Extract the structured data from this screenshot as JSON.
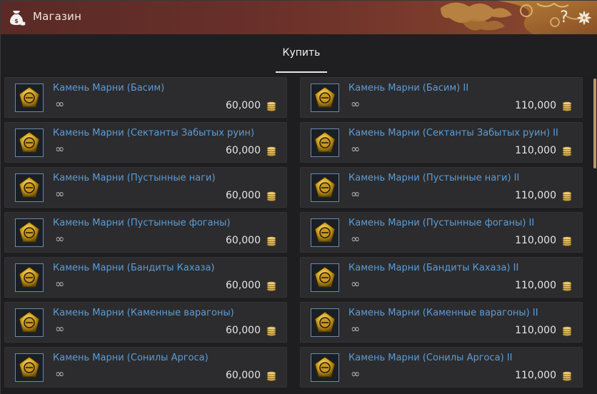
{
  "window": {
    "title": "Магазин",
    "help_label": "?"
  },
  "tabs": [
    {
      "label": "Купить",
      "active": true
    }
  ],
  "items": [
    {
      "name": "Камень Марни (Басим)",
      "quantity": "∞",
      "price": "60,000",
      "icon": "marni-stone-icon"
    },
    {
      "name": "Камень Марни (Басим) II",
      "quantity": "∞",
      "price": "110,000",
      "icon": "marni-stone-icon"
    },
    {
      "name": "Камень Марни (Сектанты Забытых руин)",
      "quantity": "∞",
      "price": "60,000",
      "icon": "marni-stone-icon"
    },
    {
      "name": "Камень Марни (Сектанты Забытых руин) II",
      "quantity": "∞",
      "price": "110,000",
      "icon": "marni-stone-icon"
    },
    {
      "name": "Камень Марни (Пустынные наги)",
      "quantity": "∞",
      "price": "60,000",
      "icon": "marni-stone-icon"
    },
    {
      "name": "Камень Марни (Пустынные наги) II",
      "quantity": "∞",
      "price": "110,000",
      "icon": "marni-stone-icon"
    },
    {
      "name": "Камень Марни (Пустынные фоганы)",
      "quantity": "∞",
      "price": "60,000",
      "icon": "marni-stone-icon"
    },
    {
      "name": "Камень Марни (Пустынные фоганы) II",
      "quantity": "∞",
      "price": "110,000",
      "icon": "marni-stone-icon"
    },
    {
      "name": "Камень Марни (Бандиты Кахаза)",
      "quantity": "∞",
      "price": "60,000",
      "icon": "marni-stone-icon"
    },
    {
      "name": "Камень Марни (Бандиты Кахаза) II",
      "quantity": "∞",
      "price": "110,000",
      "icon": "marni-stone-icon"
    },
    {
      "name": "Камень Марни (Каменные варагоны)",
      "quantity": "∞",
      "price": "60,000",
      "icon": "marni-stone-icon"
    },
    {
      "name": "Камень Марни (Каменные варагоны) II",
      "quantity": "∞",
      "price": "110,000",
      "icon": "marni-stone-icon"
    },
    {
      "name": "Камень Марни (Сонилы Аргоса)",
      "quantity": "∞",
      "price": "60,000",
      "icon": "marni-stone-icon"
    },
    {
      "name": "Камень Марни (Сонилы Аргоса) II",
      "quantity": "∞",
      "price": "110,000",
      "icon": "marni-stone-icon"
    }
  ],
  "colors": {
    "titlebar": "#6a302a",
    "item_name": "#5c9cd6",
    "card_bg": "#2c2c2e",
    "scrollbar": "#b89868"
  }
}
